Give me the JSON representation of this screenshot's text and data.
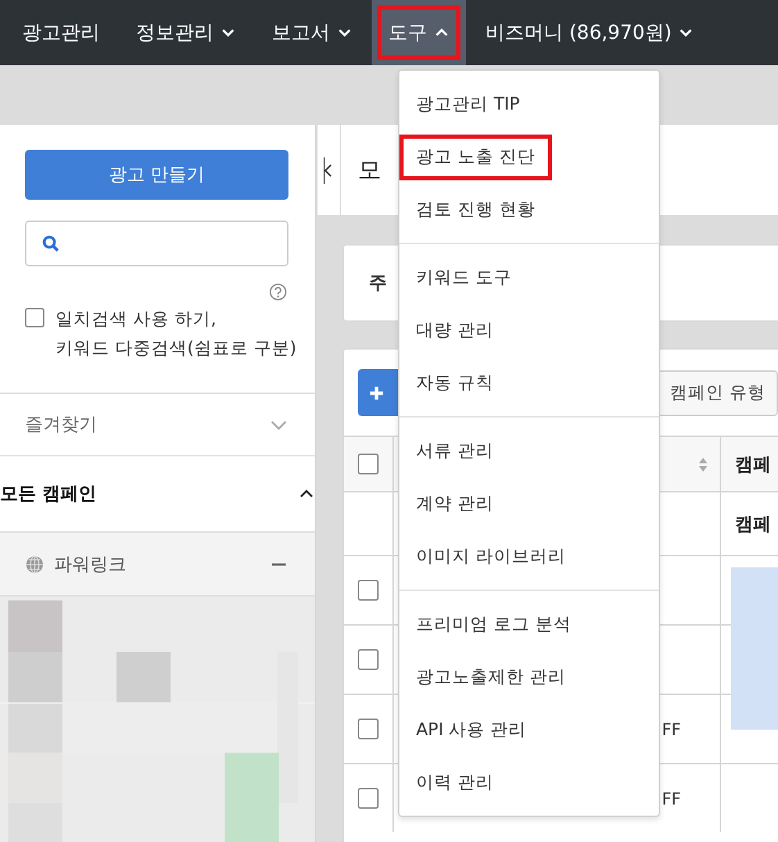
{
  "nav": [
    {
      "label": "광고관리",
      "dropdown": false,
      "selected": false,
      "highlighted": false
    },
    {
      "label": "정보관리",
      "dropdown": true,
      "selected": false,
      "highlighted": false
    },
    {
      "label": "보고서",
      "dropdown": true,
      "selected": false,
      "highlighted": false
    },
    {
      "label": "도구",
      "dropdown": true,
      "selected": true,
      "highlighted": true
    },
    {
      "label": "비즈머니 (86,970원)",
      "dropdown": true,
      "selected": false,
      "highlighted": false
    }
  ],
  "sidebar": {
    "create_button": "광고 만들기",
    "option": {
      "label_lines": [
        "일치검색 사용 하기,",
        "키워드 다중검색(쉼표로 구분)"
      ],
      "checked": false
    },
    "sections": [
      {
        "kind": "folder",
        "label": "즐겨찾기",
        "expanded": false
      },
      {
        "kind": "group",
        "label": "모든 캠페인",
        "expanded": true
      },
      {
        "kind": "channel",
        "label": "파워링크",
        "expanded": true
      }
    ]
  },
  "main": {
    "title": "모",
    "summary_label": "주",
    "filter_button": "캠페인 유형",
    "table": {
      "header_checked": false,
      "header_label": "캠페",
      "rows": [
        {
          "kind": "subheader",
          "label": "캠페"
        },
        {
          "kind": "item",
          "checked": false
        },
        {
          "kind": "item",
          "checked": false
        },
        {
          "kind": "item",
          "checked": false,
          "status": "FF"
        },
        {
          "kind": "item",
          "checked": false,
          "status": "FF"
        }
      ]
    }
  },
  "menu": {
    "groups": [
      {
        "items": [
          {
            "label": "광고관리 TIP",
            "highlighted": false
          },
          {
            "label": "광고 노출 진단",
            "highlighted": true
          },
          {
            "label": "검토 진행 현황",
            "highlighted": false
          }
        ]
      },
      {
        "items": [
          {
            "label": "키워드 도구",
            "highlighted": false
          },
          {
            "label": "대량 관리",
            "highlighted": false
          },
          {
            "label": "자동 규칙",
            "highlighted": false
          }
        ]
      },
      {
        "items": [
          {
            "label": "서류 관리",
            "highlighted": false
          },
          {
            "label": "계약 관리",
            "highlighted": false
          },
          {
            "label": "이미지 라이브러리",
            "highlighted": false
          }
        ]
      },
      {
        "items": [
          {
            "label": "프리미엄 로그 분석",
            "highlighted": false
          },
          {
            "label": "광고노출제한 관리",
            "highlighted": false
          },
          {
            "label": "API 사용 관리",
            "highlighted": false
          },
          {
            "label": "이력 관리",
            "highlighted": false
          }
        ]
      }
    ]
  }
}
